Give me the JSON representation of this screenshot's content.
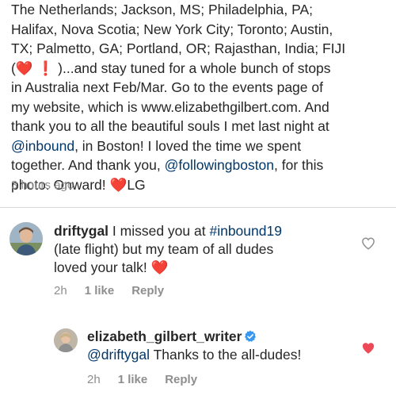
{
  "caption": {
    "line1": "The Netherlands; Jackson, MS; Philadelphia, PA;",
    "line2": "Halifax, Nova Scotia; New York City; Toronto; Austin,",
    "line3": "TX; Palmetto, GA; Portland, OR; Rajasthan, India; FIJI",
    "line4_open": "(",
    "line4_rest": " )...and stay tuned for a whole bunch of stops",
    "line5": "in Australia next Feb/Mar. Go to the events page of",
    "line6": "my website, which is www.elizabethgilbert.com. And",
    "line7": "thank you to all the beautiful souls I met last night at",
    "line8_mention": "@inbound",
    "line8_rest": ", in Boston! I loved the time we spent",
    "line9_pre": "together. And thank you, ",
    "line9_mention": "@followingboston",
    "line9_post": ", for this",
    "line10_pre": "photo. Onward! ",
    "line10_post": "LG",
    "heart_emoji": "❤️",
    "exclamation_emoji": "❗"
  },
  "post_timestamp": "3 hours ago",
  "comments": [
    {
      "username": "driftygal",
      "text_line1_pre": " I missed you at ",
      "text_line1_tag": "#inbound19",
      "text_line2": "(late flight) but my team of all dudes",
      "text_line3_pre": "loved your talk! ",
      "heart_emoji": "❤️",
      "time": "2h",
      "likes": "1 like",
      "reply": "Reply",
      "liked": false
    },
    {
      "username": "elizabeth_gilbert_writer",
      "mention": "@driftygal",
      "text": " Thanks to the all-dudes!",
      "time": "2h",
      "likes": "1 like",
      "reply": "Reply",
      "liked": true,
      "verified": true
    }
  ],
  "colors": {
    "text": "#262626",
    "link": "#00376b",
    "muted": "#8e8e8e",
    "heart": "#ed4956",
    "verified": "#3897f0"
  }
}
